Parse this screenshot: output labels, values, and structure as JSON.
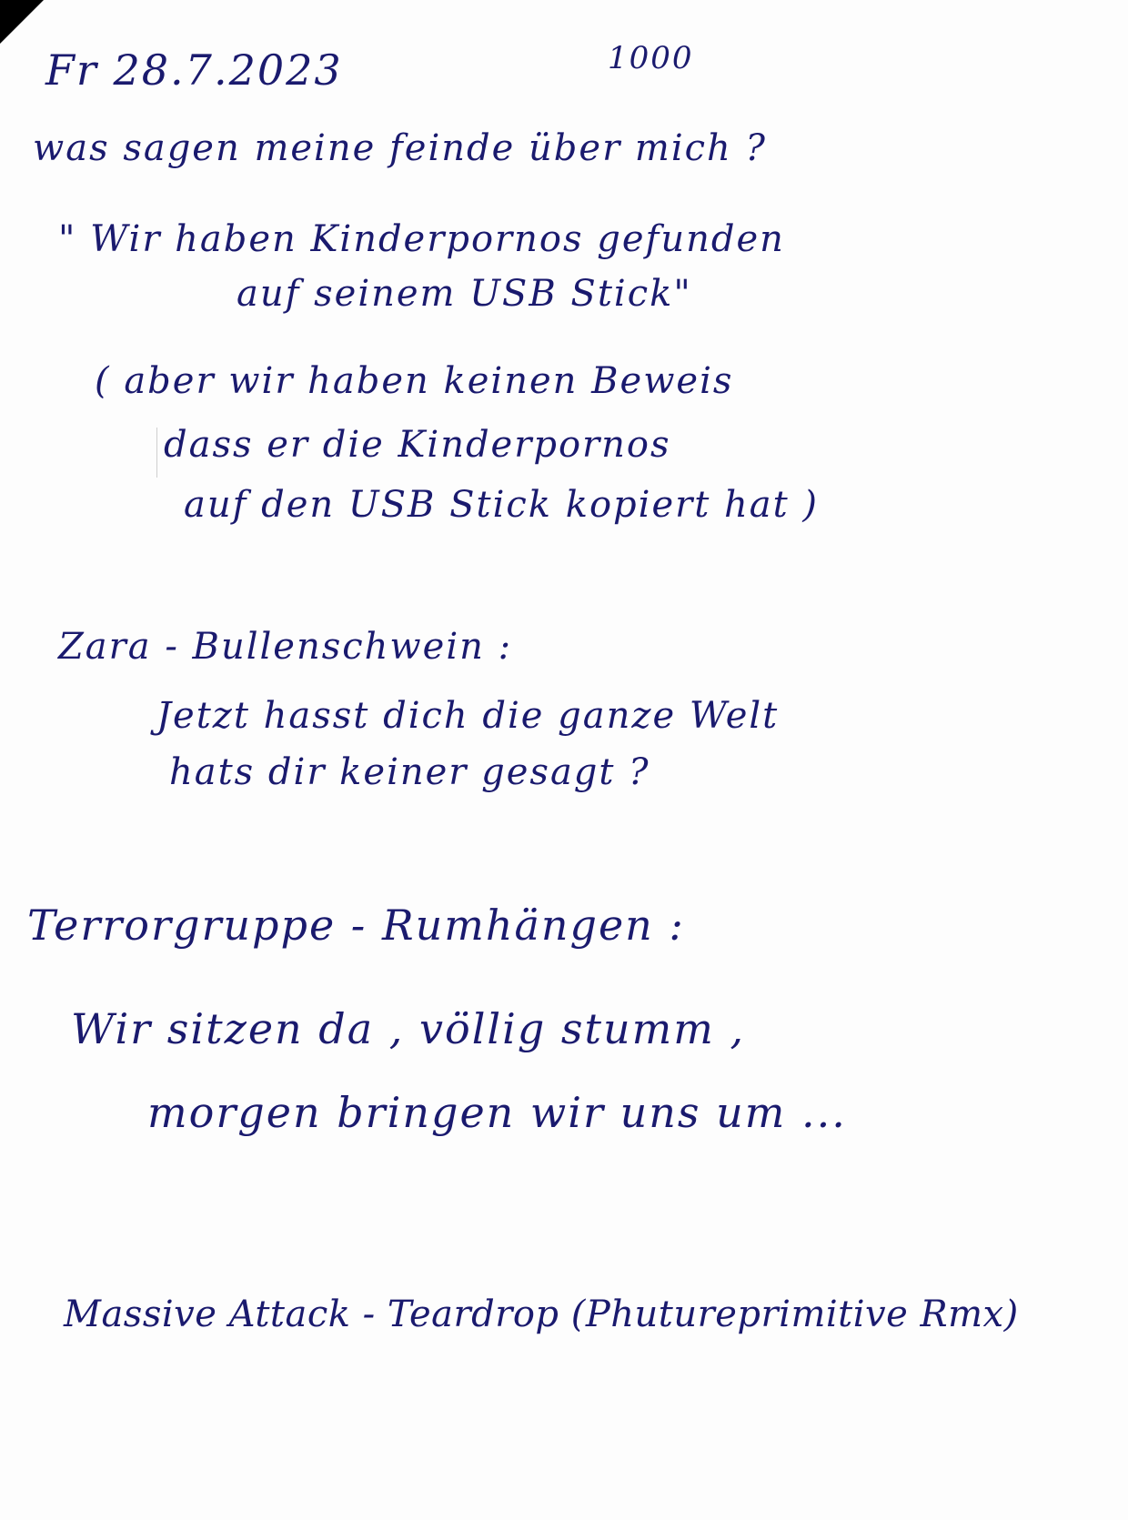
{
  "header": {
    "date": "Fr   28.7.2023",
    "time": "1000"
  },
  "lines": [
    "was sagen meine feinde über mich ?",
    "\" Wir haben Kinderpornos gefunden",
    "auf seinem USB Stick\"",
    "( aber wir haben keinen Beweis",
    "dass er die Kinderpornos",
    "auf den USB Stick kopiert hat )",
    "Zara - Bullenschwein :",
    "Jetzt hasst dich die ganze Welt",
    "hats dir keiner gesagt ?",
    "Terrorgruppe - Rumhängen :",
    "Wir sitzen da , völlig stumm ,",
    "morgen bringen wir uns um ...",
    "Massive Attack - Teardrop (Phutureprimitive Rmx)"
  ]
}
